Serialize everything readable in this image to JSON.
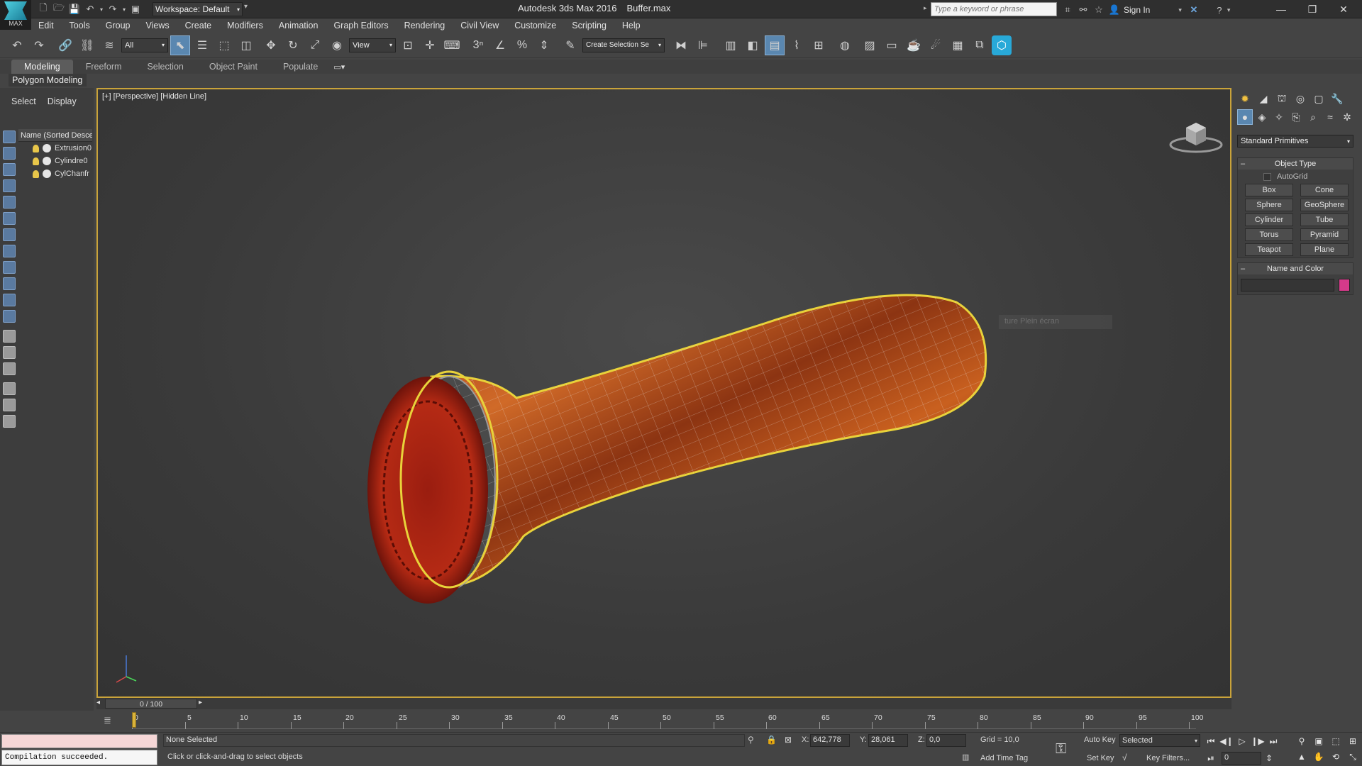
{
  "app": {
    "logo_text": "MAX",
    "workspace": "Workspace: Default",
    "title": "Autodesk 3ds Max 2016",
    "file": "Buffer.max",
    "search_placeholder": "Type a keyword or phrase",
    "sign_in": "Sign In"
  },
  "menu": [
    "Edit",
    "Tools",
    "Group",
    "Views",
    "Create",
    "Modifiers",
    "Animation",
    "Graph Editors",
    "Rendering",
    "Civil View",
    "Customize",
    "Scripting",
    "Help"
  ],
  "toolbar": {
    "filter_value": "All",
    "ref_coord_value": "View",
    "snap_3": "3",
    "named_selection_value": "Create Selection Se"
  },
  "ribbon": {
    "tabs": [
      "Modeling",
      "Freeform",
      "Selection",
      "Object Paint",
      "Populate"
    ],
    "active_tab": "Modeling",
    "panel_label": "Polygon Modeling"
  },
  "explorer": {
    "tabs": [
      "Select",
      "Display"
    ],
    "column_header": "Name (Sorted Descending)",
    "items": [
      "Extrusion0",
      "Cylindre0",
      "CylChanfr"
    ]
  },
  "viewport": {
    "label": "[+] [Perspective] [Hidden Line]",
    "overlay_text": "ture Plein écran"
  },
  "command_panel": {
    "category": "Standard Primitives",
    "object_type_title": "Object Type",
    "autogrid": "AutoGrid",
    "primitives": [
      "Box",
      "Cone",
      "Sphere",
      "GeoSphere",
      "Cylinder",
      "Tube",
      "Torus",
      "Pyramid",
      "Teapot",
      "Plane"
    ],
    "name_color_title": "Name and Color",
    "color_swatch": "#d63a8a"
  },
  "timeline": {
    "position": "0 / 100",
    "ticks": [
      "0",
      "5",
      "10",
      "15",
      "20",
      "25",
      "30",
      "35",
      "40",
      "45",
      "50",
      "55",
      "60",
      "65",
      "70",
      "75",
      "80",
      "85",
      "90",
      "95",
      "100"
    ]
  },
  "status": {
    "maxscript_output": "Compilation succeeded.",
    "selection": "None Selected",
    "prompt": "Click or click-and-drag to select objects",
    "x_label": "X:",
    "x_value": "642,778",
    "y_label": "Y:",
    "y_value": "28,061",
    "z_label": "Z:",
    "z_value": "0,0",
    "grid": "Grid = 10,0",
    "add_time_tag": "Add Time Tag",
    "auto_key": "Auto Key",
    "set_key": "Set Key",
    "key_mode": "Selected",
    "key_filters": "Key Filters...",
    "frame": "0"
  }
}
